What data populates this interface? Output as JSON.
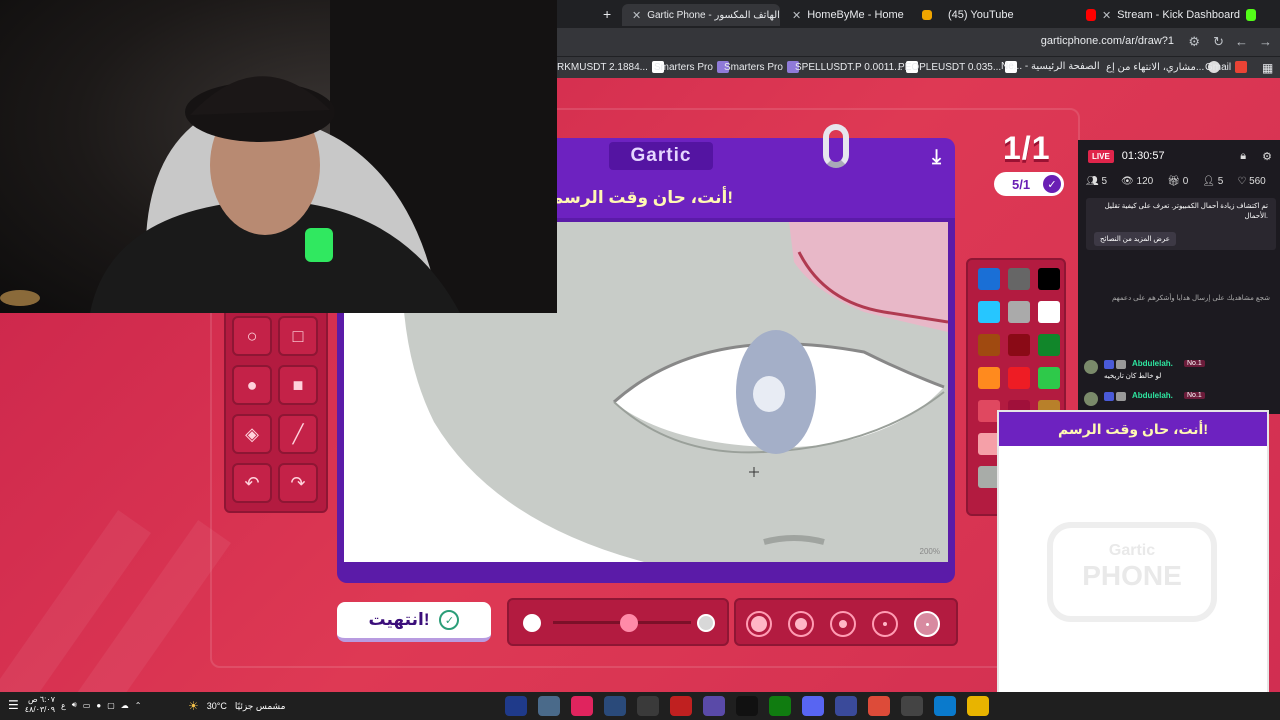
{
  "browser": {
    "tabs": [
      {
        "label": "Gartic Phone - الهاتف المكسور",
        "active": true,
        "color": "#6d22c0"
      },
      {
        "label": "HomeByMe - Home",
        "active": false,
        "color": "#f0a500"
      },
      {
        "label": "(45) YouTube",
        "active": false,
        "color": "#ff0000"
      },
      {
        "label": "Stream - Kick Dashboard",
        "active": false,
        "color": "#53fc18"
      }
    ],
    "url": "garticphone.com/ar/draw?1",
    "bookmarks": [
      {
        "label": "RKMUSDT 2.1884...",
        "icon": "tradingview-icon"
      },
      {
        "label": "Smarters Pro",
        "icon": "smarters-icon"
      },
      {
        "label": "Smarters Pro",
        "icon": "smarters-icon"
      },
      {
        "label": "SPELLUSDT.P 0.0011...",
        "icon": "tradingview-icon"
      },
      {
        "label": "PEOPLEUSDT 0.035...",
        "icon": "tradingview-icon"
      },
      {
        "label": "Ne... - الصفحة الرئيسية",
        "icon": "tradingview-icon"
      },
      {
        "label": "مشاري، الانتهاء من إع...",
        "icon": "google-icon"
      },
      {
        "label": "Gmail",
        "icon": "gmail-icon"
      }
    ]
  },
  "game": {
    "logo": "Gartic",
    "round_counter": "1/1",
    "players_done": "5/1",
    "prompt": "أنت، حان وقت الرسم!",
    "zoom": "200%",
    "finish_label": "انتهيت!",
    "palette": [
      "#1a6fd6",
      "#666666",
      "#000000",
      "#26c6ff",
      "#aaaaaa",
      "#ffffff",
      "#a04a10",
      "#8a0a16",
      "#11862a",
      "#ff8a1e",
      "#ee1c24",
      "#2ec94a",
      "#e04860",
      "#a0103a",
      "#b8802a",
      "#f5a0a8",
      "#e0346a",
      "#b06038",
      "#a8aca8",
      "#d02050",
      "#c04838"
    ],
    "brush_opacity": 0.55
  },
  "stream": {
    "live_label": "LIVE",
    "timer": "01:30:57",
    "stats": [
      {
        "icon": "users-icon",
        "value": "5"
      },
      {
        "icon": "eye-icon",
        "value": "120"
      },
      {
        "icon": "gift-icon",
        "value": "0"
      },
      {
        "icon": "user-plus-icon",
        "value": "5"
      },
      {
        "icon": "heart-icon",
        "value": "560"
      }
    ],
    "notice_text": "تم اكتشاف زيادة أحمال الكمبيوتر. تعرف على كيفية تقليل الأحمال.",
    "notice_button": "عرض المزيد من النصائح",
    "hint": "شجع مشاهديك على إرسال هدايا وأشكرهم على دعمهم",
    "messages": [
      {
        "user": "Abdulelah.",
        "rank": "No.1",
        "text": "لو خالط كان تاريخيه"
      },
      {
        "user": "Abdulelah.",
        "rank": "No.1",
        "text": ""
      }
    ]
  },
  "popup": {
    "title": "أنت، حان وقت الرسم!",
    "logo_top": "Gartic",
    "logo_bottom": "PHONE"
  },
  "taskbar": {
    "time": "٦:٠٧ ص",
    "date": "٤٨/٠٣/٠٩",
    "lang": "ع",
    "temperature": "30°C",
    "weather": "مشمس جزئيًا",
    "apps": [
      {
        "icon": "nvidia-icon",
        "color": "#1f3a8a"
      },
      {
        "icon": "explorer-icon",
        "color": "#4a6a8a"
      },
      {
        "icon": "tiktok-icon",
        "color": "#e0245e"
      },
      {
        "icon": "steam-icon",
        "color": "#2a4a7a"
      },
      {
        "icon": "settings-icon",
        "color": "#3a3a3a"
      },
      {
        "icon": "record-icon",
        "color": "#c02020"
      },
      {
        "icon": "obs-icon",
        "color": "#5a4aa8"
      },
      {
        "icon": "tiktok-live-icon",
        "color": "#111111"
      },
      {
        "icon": "xbox-icon",
        "color": "#107c10"
      },
      {
        "icon": "discord-icon",
        "color": "#5865f2"
      },
      {
        "icon": "capcut-icon",
        "color": "#3a4a9a"
      },
      {
        "icon": "chrome-icon",
        "color": "#dd4b39"
      },
      {
        "icon": "calculator-icon",
        "color": "#444444"
      },
      {
        "icon": "edge-icon",
        "color": "#0a7acc"
      },
      {
        "icon": "folder-icon",
        "color": "#e8b400"
      }
    ]
  }
}
